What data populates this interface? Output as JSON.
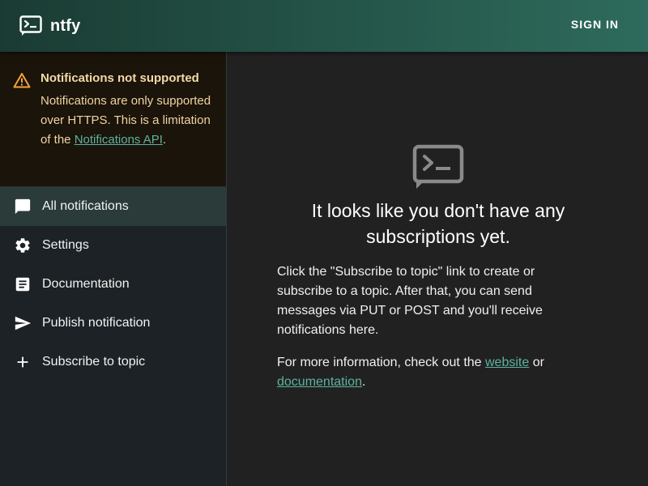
{
  "app": {
    "title": "ntfy",
    "sign_in_label": "SIGN IN"
  },
  "alert": {
    "title": "Notifications not supported",
    "body_text": "Notifications are only supported over HTTPS. This is a limitation of the ",
    "link_text": "Notifications API",
    "suffix": "."
  },
  "sidebar": {
    "items": [
      {
        "label": "All notifications",
        "icon": "chat-bubble-icon",
        "active": true
      },
      {
        "label": "Settings",
        "icon": "gear-icon",
        "active": false
      },
      {
        "label": "Documentation",
        "icon": "document-icon",
        "active": false
      },
      {
        "label": "Publish notification",
        "icon": "send-icon",
        "active": false
      },
      {
        "label": "Subscribe to topic",
        "icon": "plus-icon",
        "active": false
      }
    ]
  },
  "main": {
    "empty_icon": "terminal-icon",
    "headline": "It looks like you don't have any subscriptions yet.",
    "paragraph1": "Click the \"Subscribe to topic\" link to create or subscribe to a topic. After that, you can send messages via PUT or POST and you'll receive notifications here.",
    "paragraph2_prefix": "For more information, check out the ",
    "website_link": "website",
    "paragraph2_middle": " or ",
    "documentation_link": "documentation",
    "paragraph2_suffix": "."
  },
  "colors": {
    "appbar_start": "#1a3b33",
    "appbar_end": "#2e6b5c",
    "link": "#5db39f",
    "warning": "#f4a33a",
    "active_item": "#2a3b3a"
  }
}
